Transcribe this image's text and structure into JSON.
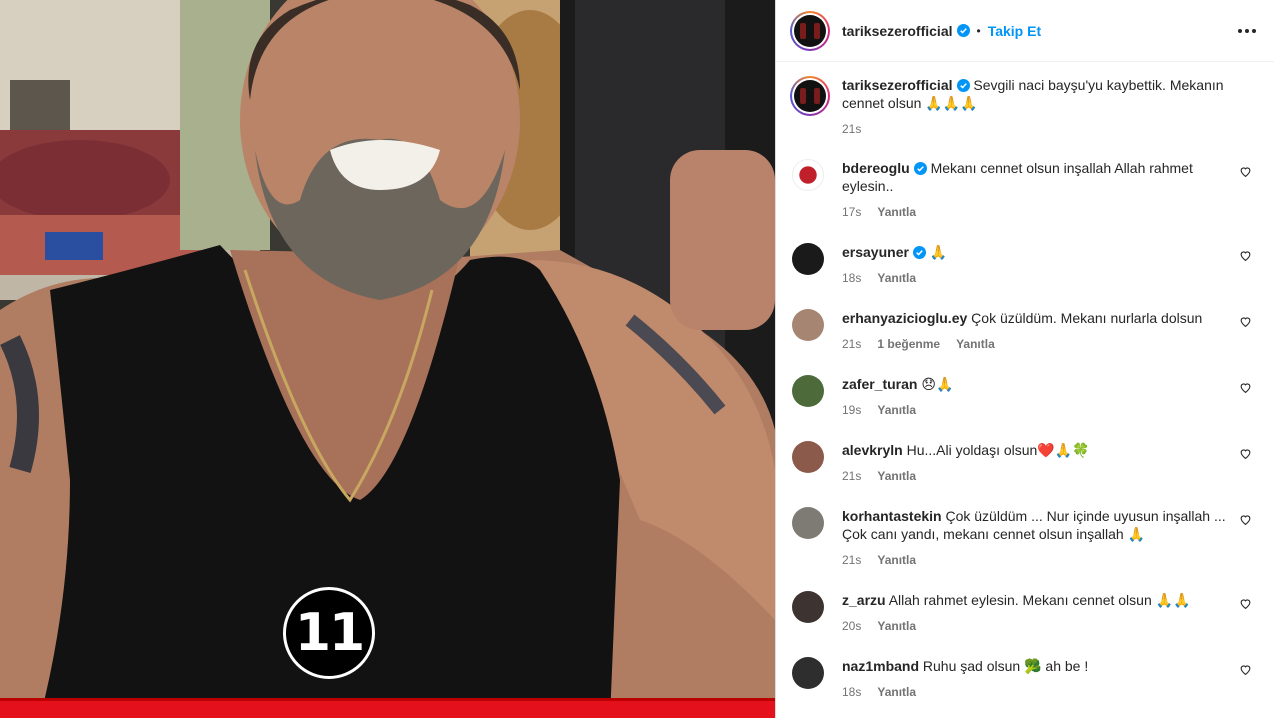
{
  "post": {
    "username": "tariksezerofficial",
    "follow_label": "Takip Et",
    "separator": "•",
    "badge_number": "11",
    "caption_text": "Sevgili naci bayşu'yu kaybettik. Mekanın cennet olsun 🙏🙏🙏",
    "caption_time": "21s"
  },
  "comments": [
    {
      "user": "bdereoglu",
      "verified": true,
      "text": "Mekanı cennet olsun inşallah Allah rahmet eylesin..",
      "time": "17s",
      "likes": "",
      "reply": "Yanıtla"
    },
    {
      "user": "ersayuner",
      "verified": true,
      "text": "🙏",
      "time": "18s",
      "likes": "",
      "reply": "Yanıtla"
    },
    {
      "user": "erhanyazicioglu.ey",
      "verified": false,
      "text": "Çok üzüldüm. Mekanı nurlarla dolsun",
      "time": "21s",
      "likes": "1 beğenme",
      "reply": "Yanıtla"
    },
    {
      "user": "zafer_turan",
      "verified": false,
      "text": "😞🙏",
      "time": "19s",
      "likes": "",
      "reply": "Yanıtla"
    },
    {
      "user": "alevkryln",
      "verified": false,
      "text": "Hu...Ali yoldaşı olsun❤️🙏🍀",
      "time": "21s",
      "likes": "",
      "reply": "Yanıtla"
    },
    {
      "user": "korhantastekin",
      "verified": false,
      "text": "Çok üzüldüm ... Nur içinde uyusun inşallah ... Çok canı yandı, mekanı cennet olsun inşallah 🙏",
      "time": "21s",
      "likes": "",
      "reply": "Yanıtla"
    },
    {
      "user": "z_arzu",
      "verified": false,
      "text": "Allah rahmet eylesin. Mekanı cennet olsun 🙏🙏",
      "time": "20s",
      "likes": "",
      "reply": "Yanıtla"
    },
    {
      "user": "naz1mband",
      "verified": false,
      "text": "Ruhu şad olsun 🥦 ah be !",
      "time": "18s",
      "likes": "",
      "reply": "Yanıtla"
    }
  ],
  "colors": {
    "accent_blue": "#0095f6",
    "red_bar": "#e4101b",
    "meta_gray": "#737373"
  },
  "icons": {
    "verified": "verified-badge-icon",
    "heart": "heart-outline-icon",
    "more": "more-options-icon"
  }
}
